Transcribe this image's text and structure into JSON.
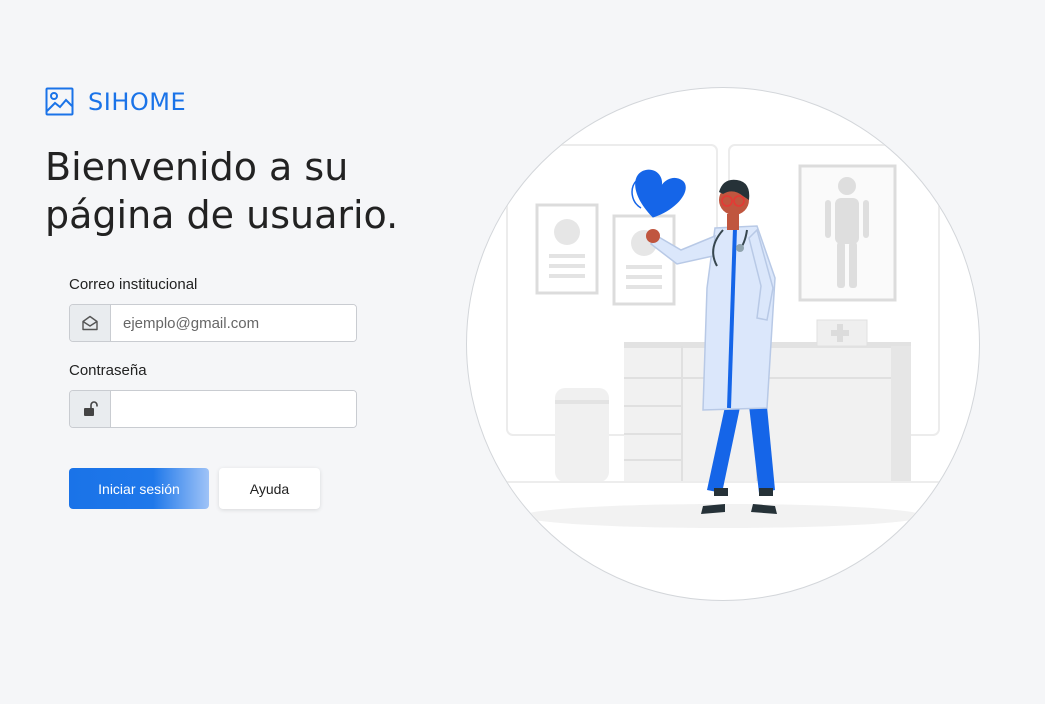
{
  "brand": {
    "name": "SIHOME",
    "icon": "image-icon",
    "color": "#1a73e8"
  },
  "headline": "Bienvenido a su página de usuario.",
  "form": {
    "email": {
      "label": "Correo institucional",
      "placeholder": "ejemplo@gmail.com",
      "value": "",
      "icon": "envelope-open-icon"
    },
    "password": {
      "label": "Contraseña",
      "placeholder": "",
      "value": "",
      "icon": "unlock-icon"
    },
    "login_button": "Iniciar sesión",
    "help_button": "Ayuda"
  },
  "illustration": {
    "subject": "doctor-holding-heart",
    "accent": "#1565e8"
  }
}
